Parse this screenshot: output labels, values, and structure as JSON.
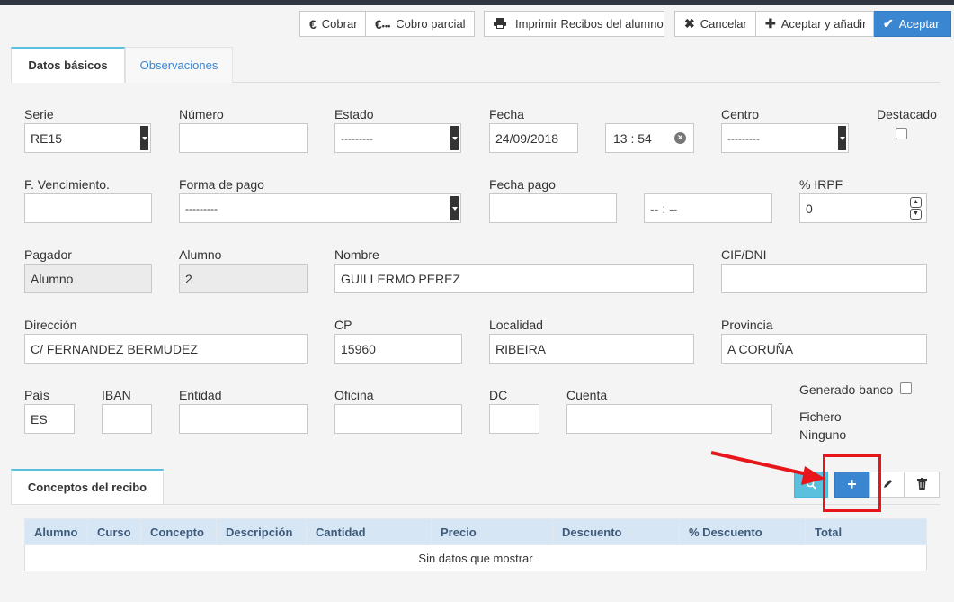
{
  "toolbar": {
    "cobrar": "Cobrar",
    "cobro_parcial": "Cobro parcial",
    "imprimir": "Imprimir Recibos del alumno",
    "cancelar": "Cancelar",
    "aceptar_anadir": "Aceptar y añadir",
    "aceptar": "Aceptar"
  },
  "tabs": [
    {
      "label": "Datos básicos"
    },
    {
      "label": "Observaciones"
    }
  ],
  "form": {
    "serie": {
      "label": "Serie",
      "value": "RE15"
    },
    "numero": {
      "label": "Número",
      "value": ""
    },
    "estado": {
      "label": "Estado",
      "value": "---------"
    },
    "fecha": {
      "label": "Fecha",
      "value": "24/09/2018",
      "time": "13 : 54"
    },
    "centro": {
      "label": "Centro",
      "value": "---------"
    },
    "destacado": {
      "label": "Destacado"
    },
    "f_vencimiento": {
      "label": "F. Vencimiento.",
      "value": ""
    },
    "forma_pago": {
      "label": "Forma de pago",
      "value": "---------"
    },
    "fecha_pago": {
      "label": "Fecha pago",
      "value": "",
      "time": "-- : --"
    },
    "irpf": {
      "label": "% IRPF",
      "value": "0"
    },
    "pagador": {
      "label": "Pagador",
      "value": "Alumno"
    },
    "alumno": {
      "label": "Alumno",
      "value": "2"
    },
    "nombre": {
      "label": "Nombre",
      "value": "GUILLERMO PEREZ"
    },
    "cif": {
      "label": "CIF/DNI",
      "value": ""
    },
    "direccion": {
      "label": "Dirección",
      "value": "C/ FERNANDEZ BERMUDEZ"
    },
    "cp": {
      "label": "CP",
      "value": "15960"
    },
    "localidad": {
      "label": "Localidad",
      "value": "RIBEIRA"
    },
    "provincia": {
      "label": "Provincia",
      "value": "A CORUÑA"
    },
    "pais": {
      "label": "País",
      "value": "ES"
    },
    "iban": {
      "label": "IBAN",
      "value": ""
    },
    "entidad": {
      "label": "Entidad",
      "value": ""
    },
    "oficina": {
      "label": "Oficina",
      "value": ""
    },
    "dc": {
      "label": "DC",
      "value": ""
    },
    "cuenta": {
      "label": "Cuenta",
      "value": ""
    },
    "generado_banco": {
      "label": "Generado banco"
    },
    "fichero": {
      "label": "Fichero",
      "value": "Ninguno"
    }
  },
  "conceptos": {
    "tab_label": "Conceptos del recibo",
    "columns": [
      "Alumno",
      "Curso",
      "Concepto",
      "Descripción",
      "Cantidad",
      "Precio",
      "Descuento",
      "% Descuento",
      "Total"
    ],
    "empty_text": "Sin datos que mostrar"
  },
  "icons": {
    "search": "search-icon",
    "add": "plus-icon",
    "edit": "pencil-icon",
    "delete": "trash-icon"
  },
  "colors": {
    "primary": "#3b86d1",
    "info": "#5bc0de",
    "annotation": "#e8151b",
    "table_header": "#d6e6f5"
  }
}
